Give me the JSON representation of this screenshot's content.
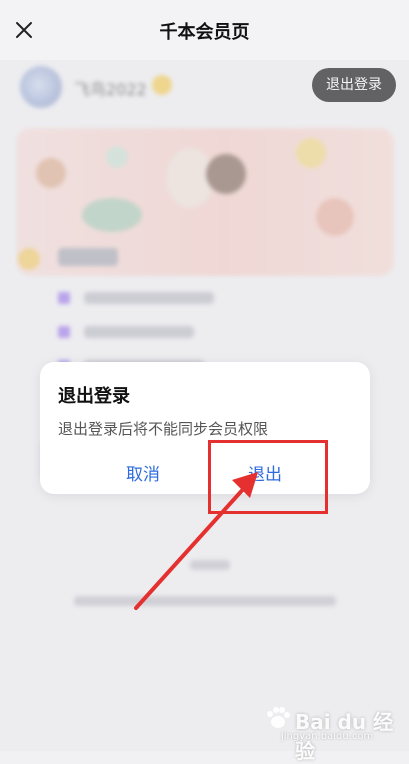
{
  "header": {
    "title": "千本会员页",
    "close_icon": "close-icon"
  },
  "profile": {
    "username": "飞鸟2022",
    "logout_button_label": "退出登录"
  },
  "dialog": {
    "title": "退出登录",
    "message": "退出登录后将不能同步会员权限",
    "cancel_label": "取消",
    "confirm_label": "退出"
  },
  "annotation": {
    "highlight_color": "#e53030",
    "accent_color": "#2d6cdf"
  },
  "watermark": {
    "brand": "Bai du 经验",
    "site": "jingyan.baidu.com"
  }
}
